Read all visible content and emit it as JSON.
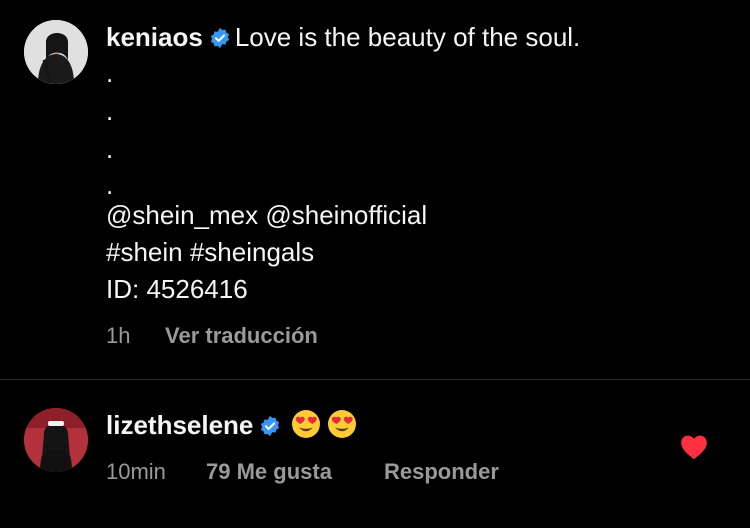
{
  "post": {
    "username": "keniaos",
    "caption": "Love is the beauty of the soul.",
    "dots": [
      ".",
      ".",
      ".",
      "."
    ],
    "mentions": "@shein_mex @sheinofficial",
    "hashtags": "#shein #sheingals",
    "id_line": "ID: 4526416",
    "time": "1h",
    "translate": "Ver traducción"
  },
  "comment": {
    "username": "lizethselene",
    "time": "10min",
    "likes": "79 Me gusta",
    "reply": "Responder"
  },
  "colors": {
    "background": "#000000",
    "text": "#f5f5f5",
    "muted": "#9a9a9a",
    "verified": "#3797f0",
    "heart": "#ff3040"
  },
  "icons": {
    "verified": "verified-badge-icon",
    "emoji": "heart-eyes-emoji-icon",
    "like": "heart-filled-icon"
  }
}
